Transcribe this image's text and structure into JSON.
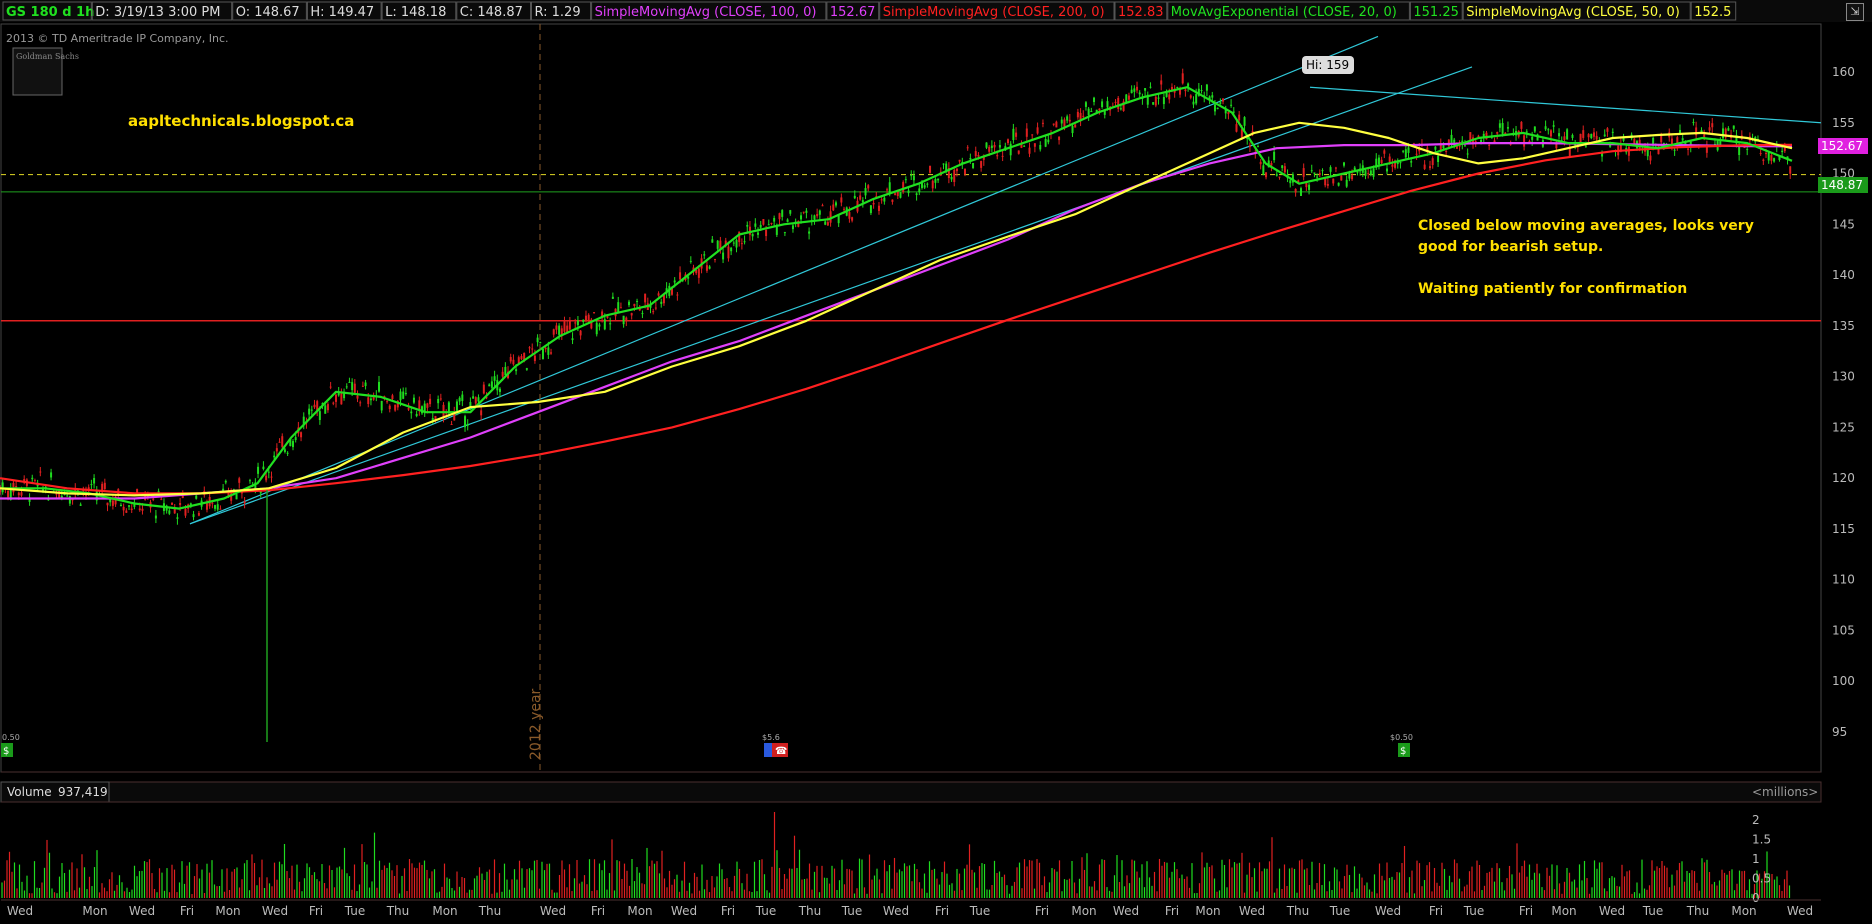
{
  "header": {
    "symbol": "GS 180 d 1h",
    "date": "D: 3/19/13 3:00 PM",
    "open": "O: 148.67",
    "high": "H: 149.47",
    "low": "L: 148.18",
    "close": "C: 148.87",
    "range": "R: 1.29",
    "studies": [
      {
        "label": "SimpleMovingAvg (CLOSE, 100, 0)",
        "value": "152.67",
        "color": "#e040fb"
      },
      {
        "label": "SimpleMovingAvg (CLOSE, 200, 0)",
        "value": "152.83",
        "color": "#ff2020"
      },
      {
        "label": "MovAvgExponential (CLOSE, 20, 0)",
        "value": "151.25",
        "color": "#20e020"
      },
      {
        "label": "SimpleMovingAvg (CLOSE, 50, 0)",
        "value": "152.5",
        "color": "#ffff40"
      }
    ]
  },
  "copyright": "2013 © TD Ameritrade IP Company, Inc.",
  "logo_text": "Goldman Sachs",
  "annotations": {
    "site": "aapltechnicals.blogspot.ca",
    "note1": "Closed below moving averages, looks very",
    "note2": "good for bearish setup.",
    "note3": "Waiting patiently for confirmation",
    "year_marker": "2012 year",
    "hi_label": "Hi: 159",
    "div1": "0.50",
    "div2": "$5.6",
    "div3": "$0.50"
  },
  "price_tags": {
    "sma100": "152.67",
    "close": "148.87"
  },
  "volume_panel": {
    "label": "Volume",
    "value": "937,419",
    "units": "<millions>",
    "ticks": [
      "2",
      "1.5",
      "1",
      "0.5",
      "0"
    ]
  },
  "chart_data": {
    "type": "line",
    "title": "GS 180 d 1h",
    "ylim": [
      92,
      164
    ],
    "y_ticks": [
      95,
      100,
      105,
      110,
      115,
      120,
      125,
      130,
      135,
      140,
      145,
      150,
      155,
      160
    ],
    "x_tick_labels": [
      "Wed",
      "Mon",
      "Wed",
      "Fri",
      "Mon",
      "Wed",
      "Fri",
      "Tue",
      "Thu",
      "Mon",
      "Thu",
      "Wed",
      "Fri",
      "Mon",
      "Wed",
      "Fri",
      "Tue",
      "Thu",
      "Tue",
      "Wed",
      "Fri",
      "Tue",
      "Fri",
      "Mon",
      "Wed",
      "Fri",
      "Mon",
      "Wed",
      "Thu",
      "Tue",
      "Wed",
      "Fri",
      "Tue",
      "Fri",
      "Mon",
      "Wed",
      "Tue",
      "Thu",
      "Mon",
      "Wed"
    ],
    "series": [
      {
        "name": "SimpleMovingAvg (CLOSE, 100, 0)",
        "color": "#e040fb",
        "x": [
          0,
          60,
          120,
          180,
          240,
          300,
          360,
          420,
          480,
          540,
          600,
          660,
          720,
          780,
          840,
          900,
          960,
          1020,
          1080,
          1140,
          1200,
          1260,
          1320,
          1380,
          1440,
          1500,
          1560,
          1600
        ],
        "values": [
          118,
          118,
          118,
          118.5,
          119,
          120,
          122,
          124,
          126.5,
          129,
          131.5,
          133.5,
          136,
          138.5,
          141,
          143.5,
          146.5,
          149,
          151,
          152.5,
          152.8,
          152.8,
          153,
          153,
          152.9,
          152.8,
          152.7,
          152.67
        ]
      },
      {
        "name": "SimpleMovingAvg (CLOSE, 200, 0)",
        "color": "#ff2020",
        "x": [
          0,
          60,
          120,
          180,
          240,
          300,
          360,
          420,
          480,
          540,
          600,
          660,
          720,
          780,
          840,
          900,
          960,
          1020,
          1080,
          1140,
          1200,
          1260,
          1320,
          1380,
          1440,
          1500,
          1560,
          1600
        ],
        "values": [
          120,
          119,
          118.5,
          118.5,
          118.8,
          119.5,
          120.3,
          121.2,
          122.3,
          123.6,
          125,
          126.8,
          128.8,
          131,
          133.3,
          135.6,
          137.8,
          140,
          142.2,
          144.3,
          146.3,
          148.3,
          150,
          151.3,
          152.2,
          152.6,
          152.8,
          152.83
        ]
      },
      {
        "name": "MovAvgExponential (CLOSE, 20, 0)",
        "color": "#20e020",
        "x": [
          0,
          40,
          80,
          120,
          160,
          200,
          230,
          260,
          300,
          340,
          380,
          420,
          460,
          500,
          540,
          580,
          620,
          660,
          700,
          740,
          780,
          820,
          860,
          900,
          940,
          980,
          1020,
          1060,
          1100,
          1130,
          1160,
          1200,
          1240,
          1280,
          1320,
          1360,
          1400,
          1440,
          1480,
          1520,
          1560,
          1600
        ],
        "values": [
          119,
          119,
          118.5,
          117.5,
          117,
          118,
          119.5,
          124,
          128.5,
          128,
          126.5,
          126.5,
          131,
          134,
          136,
          137,
          140.5,
          144,
          145,
          145.5,
          147.5,
          149,
          151,
          152.5,
          154,
          156,
          157.5,
          158.5,
          156,
          151,
          149,
          150,
          151,
          152,
          153.5,
          154,
          153,
          153,
          152.5,
          153.5,
          153,
          151.25
        ]
      },
      {
        "name": "SimpleMovingAvg (CLOSE, 50, 0)",
        "color": "#ffff40",
        "x": [
          0,
          60,
          120,
          180,
          240,
          300,
          360,
          420,
          480,
          540,
          600,
          660,
          720,
          780,
          840,
          900,
          960,
          1000,
          1040,
          1080,
          1120,
          1160,
          1200,
          1240,
          1280,
          1320,
          1360,
          1400,
          1440,
          1480,
          1520,
          1560,
          1600
        ],
        "values": [
          119,
          118.5,
          118.3,
          118.5,
          119,
          121,
          124.5,
          127,
          127.5,
          128.5,
          131,
          133,
          135.5,
          138.5,
          141.5,
          143.8,
          146,
          148,
          150,
          152,
          154,
          155,
          154.5,
          153.5,
          152,
          151,
          151.5,
          152.5,
          153.5,
          153.8,
          154,
          153.5,
          152.5
        ]
      }
    ]
  }
}
